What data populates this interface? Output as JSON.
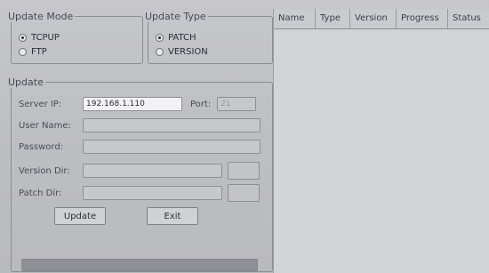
{
  "update_mode": {
    "legend": "Update Mode",
    "options": [
      {
        "label": "TCPUP",
        "selected": true
      },
      {
        "label": "FTP",
        "selected": false
      }
    ]
  },
  "update_type": {
    "legend": "Update Type",
    "options": [
      {
        "label": "PATCH",
        "selected": true
      },
      {
        "label": "VERSION",
        "selected": false
      }
    ]
  },
  "update": {
    "legend": "Update",
    "server_ip_label": "Server IP:",
    "server_ip_value": "192.168.1.110",
    "port_label": "Port:",
    "port_value": "21",
    "user_name_label": "User Name:",
    "user_name_value": "",
    "password_label": "Password:",
    "password_value": "",
    "version_dir_label": "Version Dir:",
    "version_dir_value": "",
    "patch_dir_label": "Patch Dir:",
    "patch_dir_value": "",
    "update_button": "Update",
    "exit_button": "Exit"
  },
  "table": {
    "columns": [
      "Name",
      "Type",
      "Version",
      "Progress",
      "Status"
    ]
  }
}
